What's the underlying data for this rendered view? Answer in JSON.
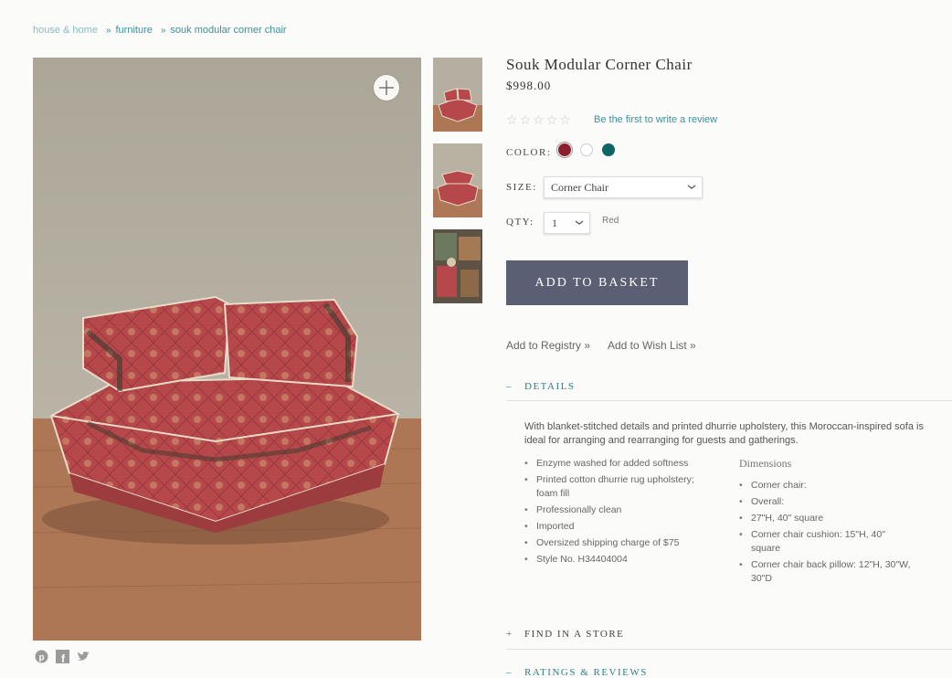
{
  "breadcrumb": {
    "items": [
      "house & home",
      "furniture",
      "souk modular corner chair"
    ],
    "separator": "»"
  },
  "product": {
    "title": "Souk Modular Corner Chair",
    "price": "$998.00",
    "rating": {
      "stars": 0,
      "max": 5,
      "review_link": "Be the first to write a review"
    },
    "color": {
      "label": "COLOR:",
      "swatches": [
        {
          "name": "red",
          "hex": "#8a1f2b",
          "selected": true
        },
        {
          "name": "white",
          "hex": "#ffffff",
          "selected": false
        },
        {
          "name": "teal",
          "hex": "#0e6466",
          "selected": false
        }
      ]
    },
    "size": {
      "label": "SIZE:",
      "value": "Corner Chair"
    },
    "qty": {
      "label": "QTY:",
      "value": "1",
      "color_note": "Red"
    },
    "add_button": "ADD TO BASKET",
    "registry_link": "Add to Registry »",
    "wishlist_link": "Add to Wish List »"
  },
  "details": {
    "heading": "DETAILS",
    "toggle": "–",
    "description": "With blanket-stitched details and printed dhurrie upholstery, this Moroccan-inspired sofa is ideal for arranging and rearranging for guests and gatherings.",
    "features": [
      "Enzyme washed for added softness",
      "Printed cotton dhurrie rug upholstery; foam fill",
      "Professionally clean",
      "Imported",
      "Oversized shipping charge of $75",
      "Style No. H34404004"
    ],
    "dimensions_title": "Dimensions",
    "dimensions": [
      "Corner chair:",
      "Overall:",
      "27\"H, 40\" square",
      "Corner chair cushion: 15\"H, 40\" square",
      "Corner chair back pillow: 12\"H, 30\"W, 30\"D"
    ]
  },
  "find_store": {
    "heading": "FIND IN A STORE",
    "toggle": "+"
  },
  "ratings": {
    "heading": "RATINGS & REVIEWS",
    "toggle": "–"
  },
  "icons": [
    "zoom-plus-icon",
    "pinterest-icon",
    "facebook-icon",
    "twitter-icon",
    "chevron-down-icon",
    "star-icon"
  ],
  "colors": {
    "accent": "#3f8f96",
    "button": "#5b5f73",
    "background": "#fbfbf9"
  }
}
